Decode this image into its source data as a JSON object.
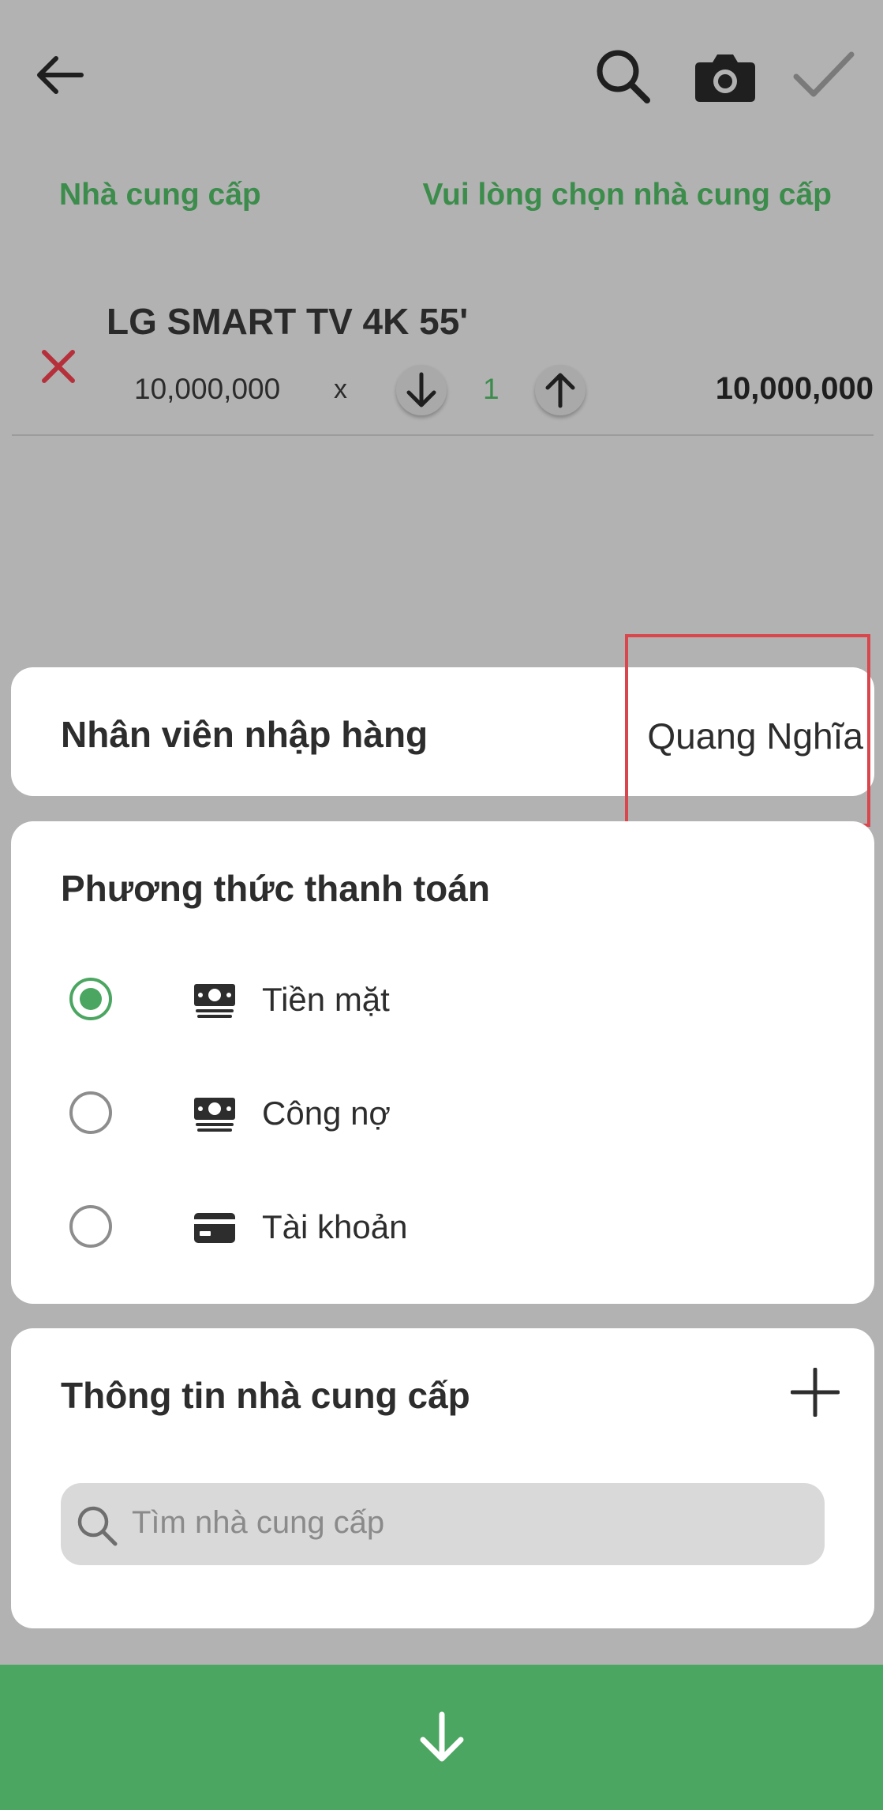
{
  "header": {
    "back_icon": "arrow-left-icon",
    "search_icon": "search-icon",
    "camera_icon": "camera-icon",
    "confirm_icon": "checkmark-icon"
  },
  "supplier": {
    "label": "Nhà cung cấp",
    "value": "Vui lòng chọn nhà cung cấp"
  },
  "product": {
    "name": "LG SMART TV 4K 55'",
    "price": "10,000,000",
    "multiply": "x",
    "quantity": "1",
    "total": "10,000,000"
  },
  "employee": {
    "label": "Nhân viên nhập hàng",
    "value": "Quang Nghĩa"
  },
  "payment": {
    "title": "Phương thức thanh toán",
    "options": [
      {
        "label": "Tiền mặt",
        "icon": "cash-icon",
        "selected": true
      },
      {
        "label": "Công nợ",
        "icon": "cash-icon",
        "selected": false
      },
      {
        "label": "Tài khoản",
        "icon": "credit-card-icon",
        "selected": false
      }
    ]
  },
  "supplier_info": {
    "title": "Thông tin nhà cung cấp",
    "add_icon": "plus-icon",
    "search_placeholder": "Tìm nhà cung cấp"
  },
  "bottom": {
    "icon": "arrow-down-icon"
  },
  "colors": {
    "accent_green": "#4aa660",
    "text_green": "#3c8c4c",
    "remove_red": "#b5303a",
    "highlight_red": "#d9464c",
    "overlay_gray": "#b2b2b2"
  }
}
